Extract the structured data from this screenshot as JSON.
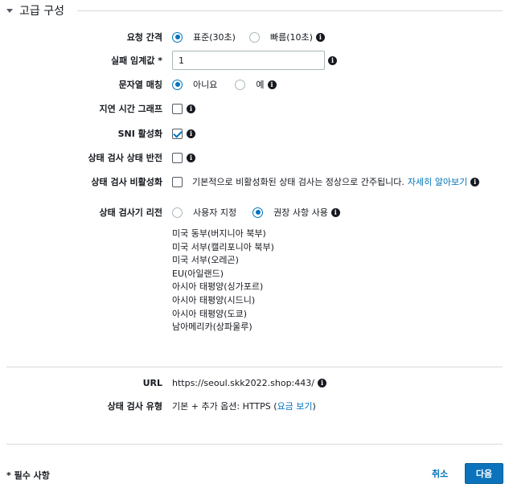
{
  "section": {
    "title": "고급 구성"
  },
  "request_interval": {
    "label": "요청 간격",
    "options": [
      {
        "label": "표준(30초)",
        "selected": true
      },
      {
        "label": "빠름(10초)",
        "selected": false
      }
    ]
  },
  "failure_threshold": {
    "label": "실패 임계값 *",
    "value": "1"
  },
  "string_matching": {
    "label": "문자열 매칭",
    "options": [
      {
        "label": "아니요",
        "selected": true
      },
      {
        "label": "예",
        "selected": false
      }
    ]
  },
  "latency_graph": {
    "label": "지연 시간 그래프",
    "checked": false
  },
  "sni": {
    "label": "SNI 활성화",
    "checked": true
  },
  "invert_status": {
    "label": "상태 검사 상태 반전",
    "checked": false
  },
  "disable_check": {
    "label": "상태 검사 비활성화",
    "checked": false,
    "description": "기본적으로 비활성화된 상태 검사는 정상으로 간주됩니다.",
    "link": "자세히 알아보기"
  },
  "regions": {
    "label": "상태 검사기 리전",
    "options": [
      {
        "label": "사용자 지정",
        "selected": false
      },
      {
        "label": "권장 사항 사용",
        "selected": true
      }
    ],
    "list": [
      "미국 동부(버지니아 북부)",
      "미국 서부(캘리포니아 북부)",
      "미국 서부(오레곤)",
      "EU(아일랜드)",
      "아시아 태평양(싱가포르)",
      "아시아 태평양(시드니)",
      "아시아 태평양(도쿄)",
      "남아메리카(상파울루)"
    ]
  },
  "url": {
    "label": "URL",
    "value": "https://seoul.skk2022.shop:443/"
  },
  "check_type": {
    "label": "상태 검사 유형",
    "prefix": "기본 + 추가 옵션: HTTPS (",
    "link": "요금 보기",
    "suffix": ")"
  },
  "footer": {
    "required_note": "* 필수 사항",
    "cancel": "취소",
    "next": "다음"
  },
  "colors": {
    "accent": "#0073bb",
    "primary_button": "#0b73bb"
  }
}
